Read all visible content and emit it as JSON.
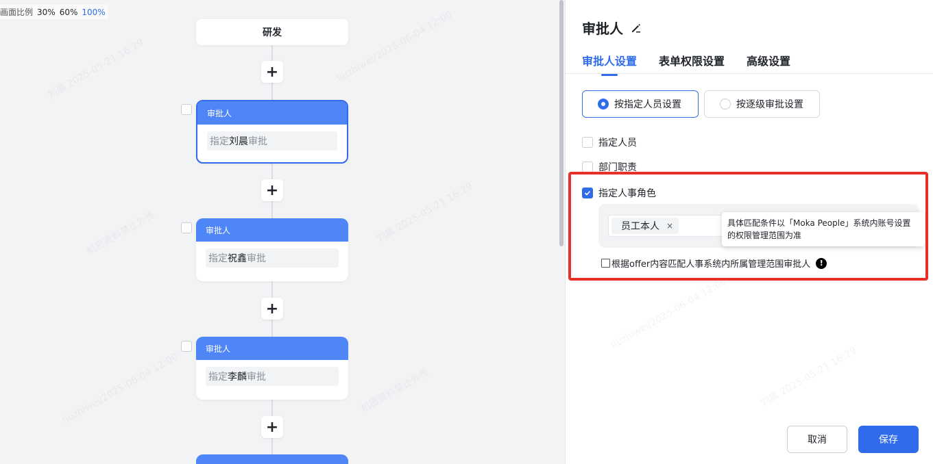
{
  "zoom": {
    "label": "画面比例",
    "options": [
      "30%",
      "60%",
      "100%"
    ],
    "active": "100%"
  },
  "flow": {
    "start_node": "研发",
    "plus_symbol": "+",
    "nodes": [
      {
        "header": "审批人",
        "prefix": "指定",
        "name": "刘晨",
        "suffix": "审批",
        "selected": true
      },
      {
        "header": "审批人",
        "prefix": "指定",
        "name": "祝鑫",
        "suffix": "审批",
        "selected": false
      },
      {
        "header": "审批人",
        "prefix": "指定",
        "name": "李麟",
        "suffix": "审批",
        "selected": false
      }
    ]
  },
  "panel": {
    "title": "审批人",
    "tabs": [
      "审批人设置",
      "表单权限设置",
      "高级设置"
    ],
    "active_tab": "审批人设置",
    "mode_options": [
      "按指定人员设置",
      "按逐级审批设置"
    ],
    "mode_selected": "按指定人员设置",
    "checkbox_options": [
      {
        "label": "指定人员",
        "checked": false
      },
      {
        "label": "部门职责",
        "checked": false
      },
      {
        "label": "指定人事角色",
        "checked": true
      }
    ],
    "role_tag": "员工本人",
    "tag_close": "×",
    "tooltip_line1": "具体匹配条件以「Moka People」系统内账号设置",
    "tooltip_line2": "的权限管理范围为准",
    "offer_option": "根据offer内容匹配人事系统内所属管理范围审批人",
    "warn_symbol": "!",
    "cancel_label": "取消",
    "save_label": "保存"
  },
  "colors": {
    "accent": "#2f6bea",
    "node_header": "#4f86f7",
    "highlight": "#e8302a"
  },
  "watermark": {
    "texts": [
      "刘晨 2025-05-21 16:29",
      "liuzhiwei/2025-06-04 12:00",
      "机密资料禁止外传"
    ]
  }
}
